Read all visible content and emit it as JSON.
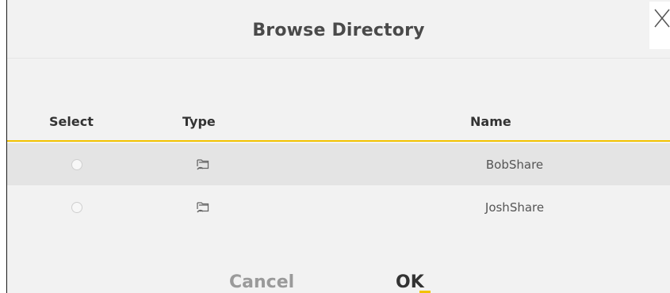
{
  "dialog": {
    "title": "Browse Directory",
    "close_icon": "close-icon"
  },
  "table": {
    "columns": [
      "Select",
      "Type",
      "Name"
    ],
    "rows": [
      {
        "selected": false,
        "type_icon": "folder-share-icon",
        "name": "BobShare"
      },
      {
        "selected": false,
        "type_icon": "folder-share-icon",
        "name": "JoshShare"
      }
    ]
  },
  "buttons": {
    "cancel_label": "Cancel",
    "ok_label": "OK"
  },
  "colors": {
    "accent": "#f2c200",
    "dialog_bg": "#f2f2f2",
    "row_highlight": "#e4e4e4"
  }
}
